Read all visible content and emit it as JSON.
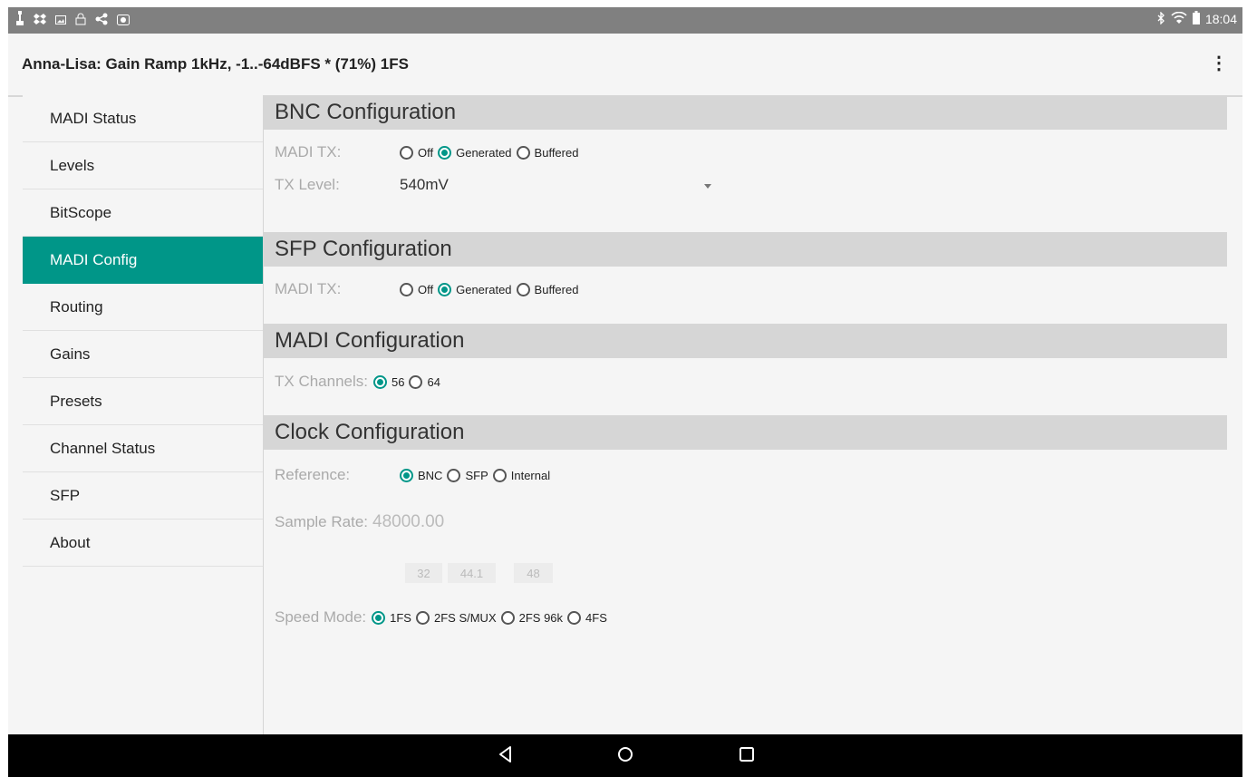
{
  "status_bar": {
    "left_icons": [
      "usb-icon",
      "dropbox-icon",
      "image-icon",
      "lock-icon",
      "share-icon",
      "photo-icon"
    ],
    "right_icons": [
      "bluetooth-icon",
      "wifi-icon",
      "battery-icon"
    ],
    "time": "18:04"
  },
  "app_bar": {
    "title": "Anna-Lisa: Gain Ramp 1kHz, -1..-64dBFS * (71%) 1FS",
    "overflow": "⋮"
  },
  "sidebar": {
    "items": [
      {
        "label": "MADI Status",
        "active": false
      },
      {
        "label": "Levels",
        "active": false
      },
      {
        "label": "BitScope",
        "active": false
      },
      {
        "label": "MADI Config",
        "active": true
      },
      {
        "label": "Routing",
        "active": false
      },
      {
        "label": "Gains",
        "active": false
      },
      {
        "label": "Presets",
        "active": false
      },
      {
        "label": "Channel Status",
        "active": false
      },
      {
        "label": "SFP",
        "active": false
      },
      {
        "label": "About",
        "active": false
      }
    ]
  },
  "bnc": {
    "title": "BNC Configuration",
    "madi_tx_label": "MADI TX:",
    "madi_tx_options": [
      "Off",
      "Generated",
      "Buffered"
    ],
    "madi_tx_selected": "Generated",
    "tx_level_label": "TX Level:",
    "tx_level_value": "540mV"
  },
  "sfp": {
    "title": "SFP Configuration",
    "madi_tx_label": "MADI TX:",
    "madi_tx_options": [
      "Off",
      "Generated",
      "Buffered"
    ],
    "madi_tx_selected": "Generated"
  },
  "madi": {
    "title": "MADI Configuration",
    "tx_channels_label": "TX Channels:",
    "tx_channels_options": [
      "56",
      "64"
    ],
    "tx_channels_selected": "56"
  },
  "clock": {
    "title": "Clock Configuration",
    "reference_label": "Reference:",
    "reference_options": [
      "BNC",
      "SFP",
      "Internal"
    ],
    "reference_selected": "BNC",
    "sample_rate_label": "Sample Rate:",
    "sample_rate_value": "48000.00",
    "rate_buttons": [
      "32",
      "44.1",
      "48"
    ],
    "speed_mode_label": "Speed Mode:",
    "speed_mode_options": [
      "1FS",
      "2FS S/MUX",
      "2FS 96k",
      "4FS"
    ],
    "speed_mode_selected": "1FS"
  },
  "colors": {
    "accent": "#009688",
    "status_bar": "#808080",
    "nav_bar": "#000000",
    "section_header": "#d6d6d6"
  }
}
